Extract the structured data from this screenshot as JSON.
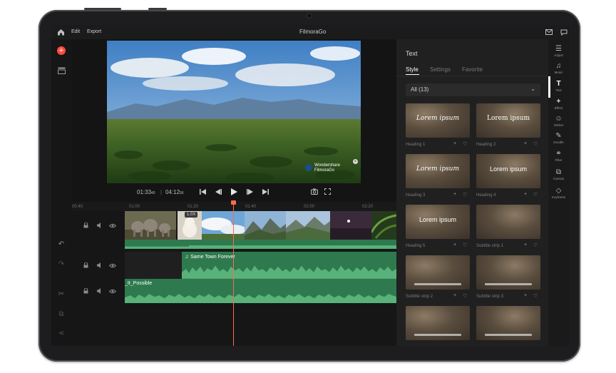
{
  "app": {
    "title": "FilmoraGo",
    "menu": {
      "edit": "Edit",
      "export": "Export"
    }
  },
  "preview": {
    "current_time": "01:33",
    "current_frames": "40",
    "total_time": "04:12",
    "total_frames": "56",
    "watermark_line1": "Wondershare",
    "watermark_line2": "FilmoraGo"
  },
  "timeline": {
    "ruler_labels": [
      "00:40",
      "01:00",
      "01:20",
      "01:40",
      "02:00",
      "02:20"
    ],
    "speed_badge": "1.0X",
    "music_track_label": "Same Town Forever",
    "second_audio_label": "_It_Possible"
  },
  "panel": {
    "title": "Text",
    "tabs": [
      "Style",
      "Settings",
      "Favorite"
    ],
    "active_tab": "Style",
    "filter_value": "All (13)",
    "templates": [
      {
        "preview_text": "Lorem ipsum",
        "label": "Heading 1"
      },
      {
        "preview_text": "Lorem ipsum",
        "label": "Heading 2"
      },
      {
        "preview_text": "Lorem ipsum",
        "label": "Heading 3"
      },
      {
        "preview_text": "Lorem ipsum",
        "label": "Heading 4"
      },
      {
        "preview_text": "Lorem ipsum",
        "label": "Heading 5"
      },
      {
        "preview_text": "",
        "label": "Subtitle strip 1"
      },
      {
        "preview_text": "",
        "label": "Subtitle strip 2"
      },
      {
        "preview_text": "",
        "label": "Subtitle strip 3"
      },
      {
        "preview_text": "",
        "label": ""
      },
      {
        "preview_text": "",
        "label": ""
      }
    ]
  },
  "right_toolbar": [
    {
      "icon": "adjust-icon",
      "label": "Adjust"
    },
    {
      "icon": "music-icon",
      "label": "Music"
    },
    {
      "icon": "text-icon",
      "label": "Text"
    },
    {
      "icon": "effect-icon",
      "label": "Effect"
    },
    {
      "icon": "sticker-icon",
      "label": "Sticker"
    },
    {
      "icon": "doodle-icon",
      "label": "Doodle"
    },
    {
      "icon": "filter-icon",
      "label": "Filter"
    },
    {
      "icon": "canvas-icon",
      "label": "Canvas"
    },
    {
      "icon": "keyframe-icon",
      "label": "Keyframe"
    }
  ],
  "colors": {
    "accent": "#ff4d3d",
    "audio_track": "#2e7a4e",
    "panel_bg": "#202020"
  }
}
